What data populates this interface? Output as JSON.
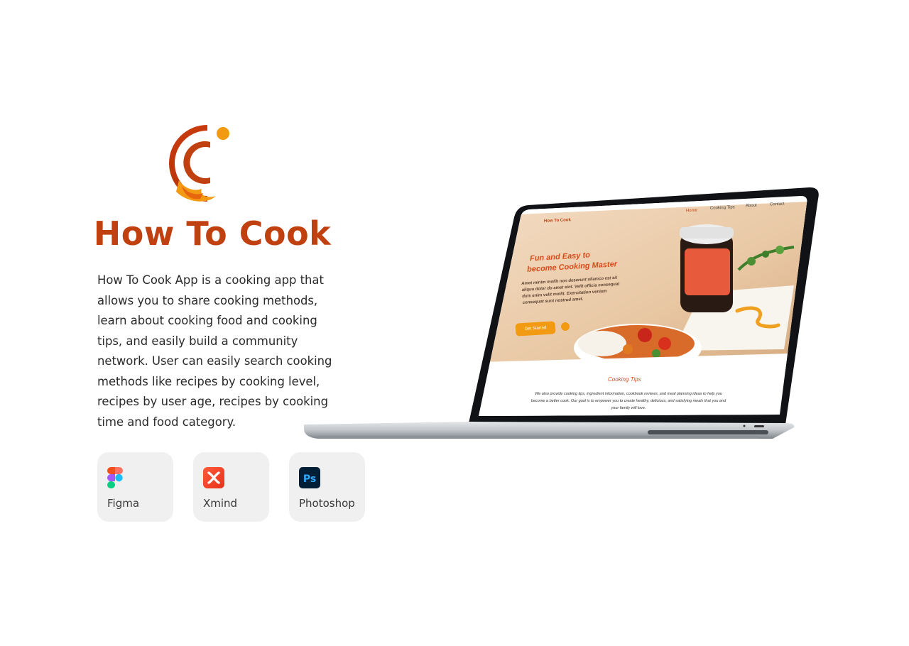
{
  "brand": {
    "title": "How To Cook",
    "logo_icon": "cooking-c-logo",
    "accent": "#c0400f",
    "accent_light": "#f39a13"
  },
  "description": "How To Cook App is a cooking app that allows you to share cooking methods, learn about cooking food and cooking tips, and easily build a community network. User can easily search cooking methods like recipes by cooking level, recipes by user age, recipes by cooking time and food category.",
  "tools": [
    {
      "label": "Figma",
      "icon": "figma-icon"
    },
    {
      "label": "Xmind",
      "icon": "xmind-icon"
    },
    {
      "label": "Photoshop",
      "icon": "photoshop-icon"
    }
  ],
  "mockup": {
    "site_logo_text": "How To Cook",
    "nav": [
      "Home",
      "Cooking Tips",
      "About",
      "Contact"
    ],
    "hero_title_line1": "Fun and Easy to",
    "hero_title_line2": "become Cooking Master",
    "hero_body": [
      "Amet minim mollit non deserunt ullamco est sit",
      "aliqua dolor do amet sint. Velit officia consequat",
      "duis enim velit mollit. Exercitation veniam",
      "consequat sunt nostrud amet."
    ],
    "cta_label": "Get Started",
    "section_title": "Cooking Tips",
    "section_body": [
      "We also provide cooking tips, ingredient information, cookbook reviews, and meal planning ideas to help you",
      "become a better cook. Our goal is to empower you to create healthy, delicious, and satisfying meals that you and",
      "your family will love."
    ]
  }
}
